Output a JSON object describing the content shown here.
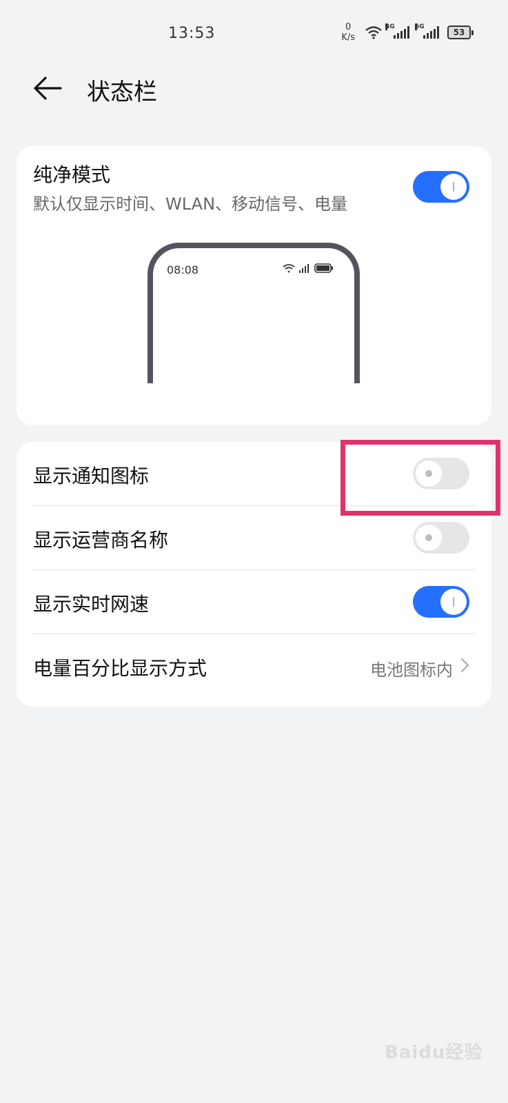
{
  "status_bar": {
    "time": "13:53",
    "net_speed_value": "0",
    "net_speed_unit": "K/s",
    "signal1_label": "4G",
    "signal2_label": "5G",
    "battery": "53"
  },
  "header": {
    "title": "状态栏",
    "back_icon": "arrow-left-icon"
  },
  "pure_mode": {
    "title": "纯净模式",
    "subtitle": "默认仅显示时间、WLAN、移动信号、电量",
    "enabled": true,
    "preview_time": "08:08"
  },
  "settings": [
    {
      "label": "显示通知图标",
      "type": "toggle",
      "enabled": false
    },
    {
      "label": "显示运营商名称",
      "type": "toggle",
      "enabled": false
    },
    {
      "label": "显示实时网速",
      "type": "toggle",
      "enabled": true
    },
    {
      "label": "电量百分比显示方式",
      "type": "select",
      "value": "电池图标内"
    }
  ],
  "colors": {
    "accent": "#256fff",
    "highlight": "#e0336e",
    "background": "#f1f3f5"
  },
  "watermark": "Baidu经验"
}
